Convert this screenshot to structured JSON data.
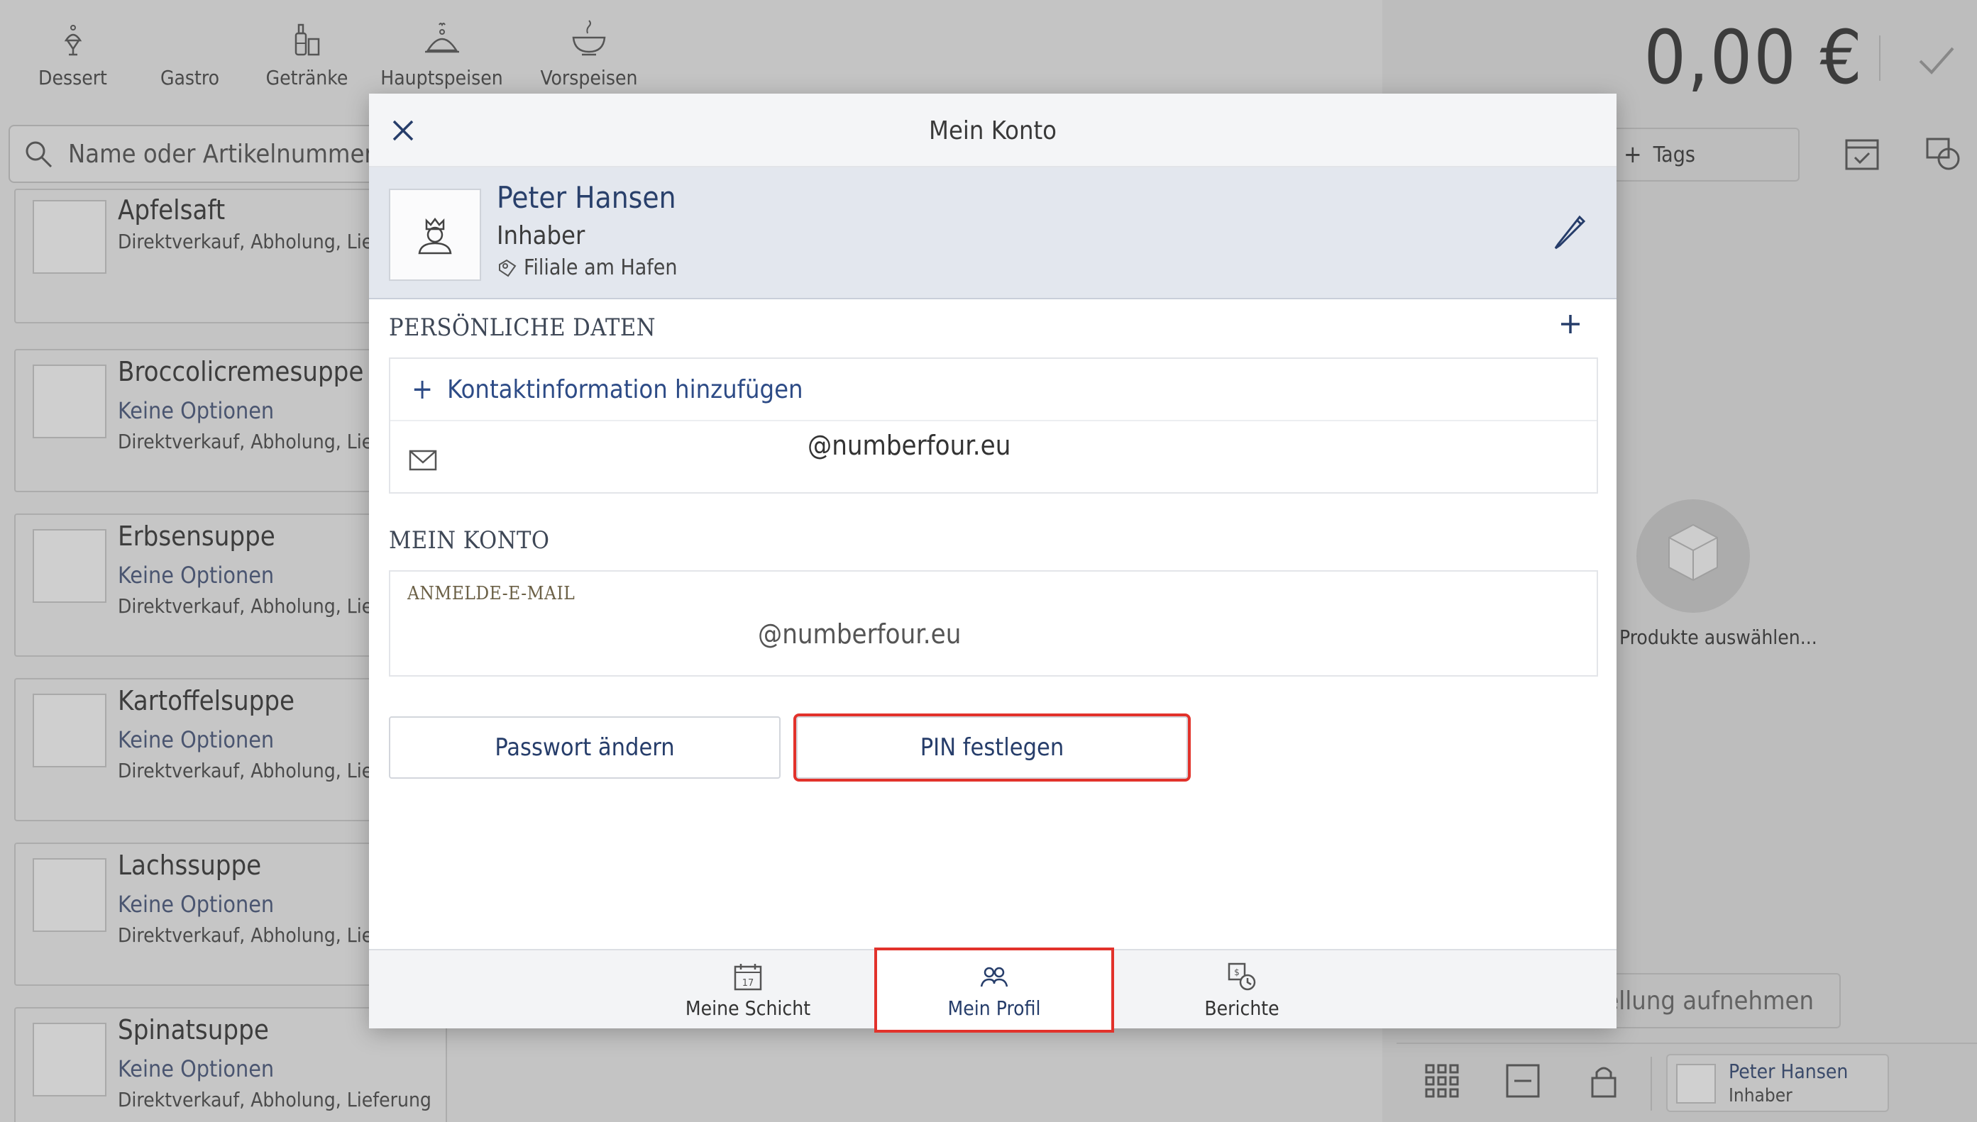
{
  "categories": [
    {
      "label": "Dessert",
      "icon": "dessert-icon"
    },
    {
      "label": "Gastro",
      "icon": "gastro-icon"
    },
    {
      "label": "Getränke",
      "icon": "drinks-icon"
    },
    {
      "label": "Hauptspeisen",
      "icon": "main-dishes-icon"
    },
    {
      "label": "Vorspeisen",
      "icon": "starters-icon"
    }
  ],
  "search": {
    "placeholder": "Name oder Artikelnummer ei"
  },
  "products": [
    {
      "name": "Apfelsaft",
      "options": "",
      "channels": "Direktverkauf, Abholung, Lief"
    },
    {
      "name": "Broccolicremesuppe",
      "options": "Keine Optionen",
      "channels": "Direktverkauf, Abholung, Lief"
    },
    {
      "name": "Erbsensuppe",
      "options": "Keine Optionen",
      "channels": "Direktverkauf, Abholung, Lief"
    },
    {
      "name": "Kartoffelsuppe",
      "options": "Keine Optionen",
      "channels": "Direktverkauf, Abholung, Lief"
    },
    {
      "name": "Lachssuppe",
      "options": "Keine Optionen",
      "channels": "Direktverkauf, Abholung, Lief"
    },
    {
      "name": "Spinatsuppe",
      "options": "Keine Optionen",
      "channels": "Direktverkauf, Abholung, Lieferung"
    }
  ],
  "cart": {
    "total": "0,00 €",
    "tags_label": "Tags",
    "empty_label": "Produkte auswählen...",
    "order_button": "ellung aufnehmen",
    "user_name": "Peter Hansen",
    "user_role": "Inhaber"
  },
  "modal": {
    "title": "Mein Konto",
    "profile": {
      "name": "Peter Hansen",
      "role": "Inhaber",
      "branch": "Filiale am Hafen"
    },
    "personal_section": {
      "title": "PERSÖNLICHE DATEN",
      "add_contact": "Kontaktinformation hinzufügen",
      "email": "@numberfour.eu"
    },
    "account_section": {
      "title": "MEIN KONTO",
      "login_email_label": "ANMELDE-E-MAIL",
      "login_email": "@numberfour.eu"
    },
    "buttons": {
      "change_password": "Passwort ändern",
      "set_pin": "PIN festlegen"
    },
    "tabs": [
      {
        "label": "Meine Schicht",
        "icon": "calendar-icon"
      },
      {
        "label": "Mein Profil",
        "icon": "profile-icon"
      },
      {
        "label": "Berichte",
        "icon": "reports-icon"
      }
    ]
  },
  "colors": {
    "accent": "#263d6a",
    "highlight": "#e2322b",
    "profile_bg": "#e3e7ee"
  }
}
